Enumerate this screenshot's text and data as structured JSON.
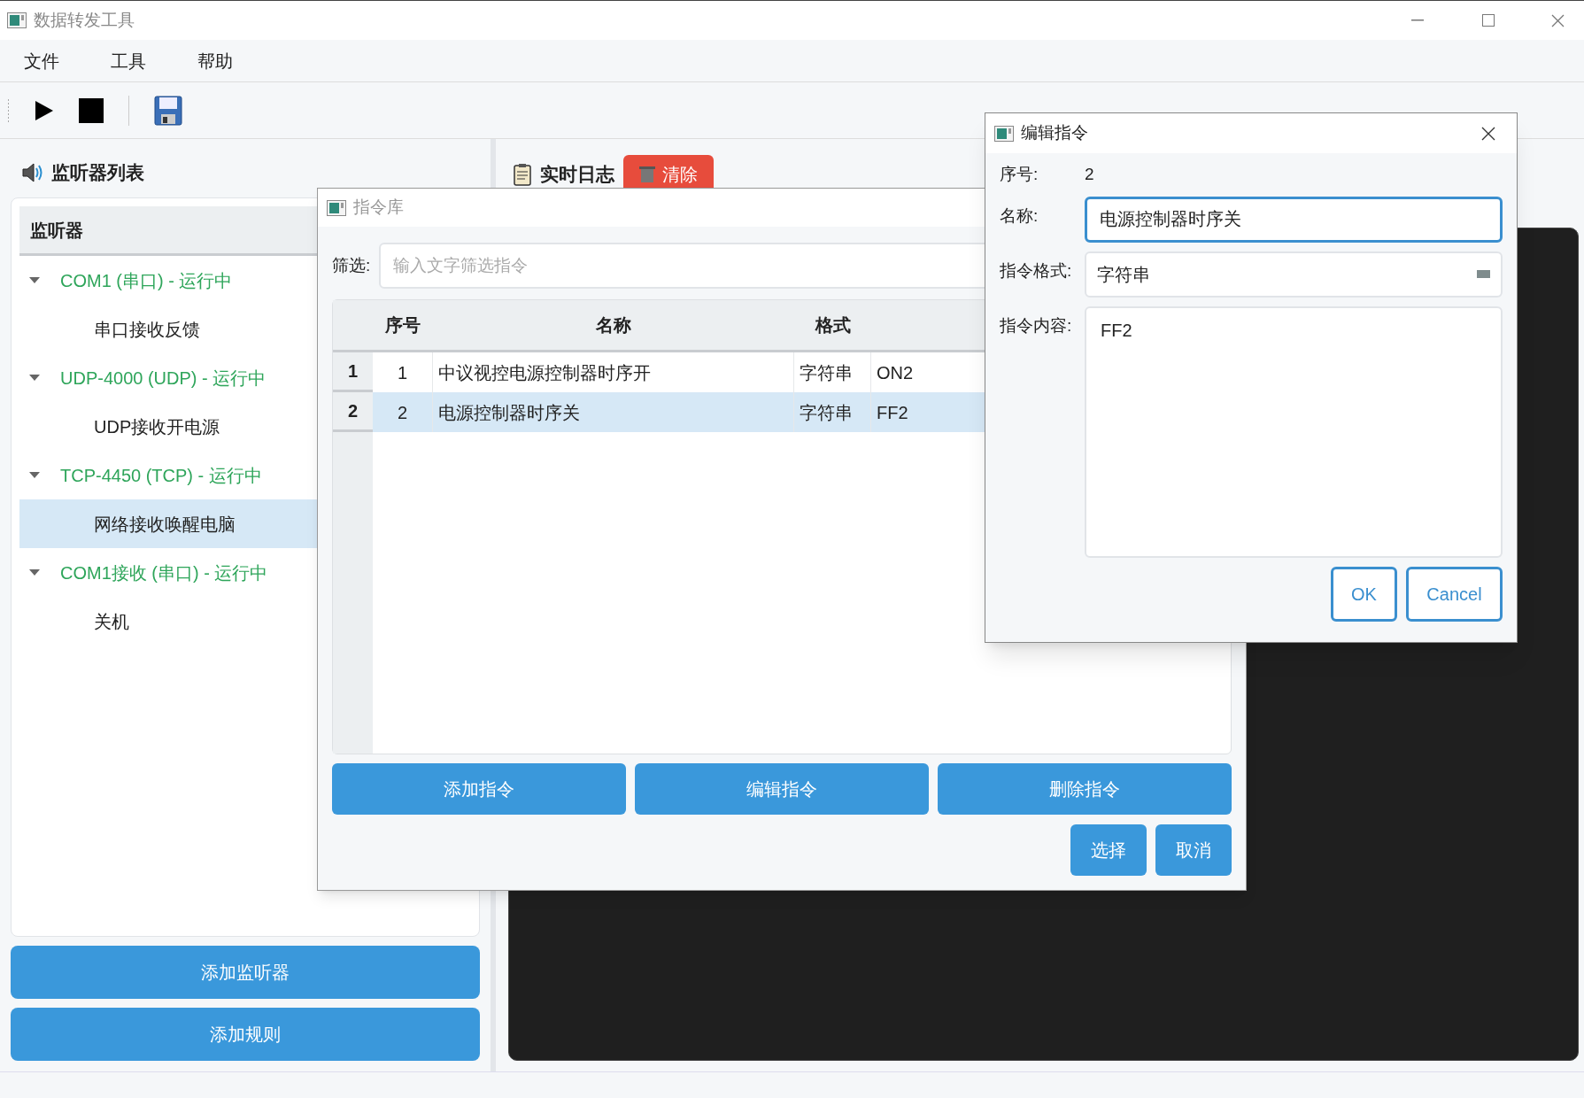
{
  "window": {
    "title": "数据转发工具"
  },
  "menu": [
    "文件",
    "工具",
    "帮助"
  ],
  "left_panel": {
    "title": "监听器列表",
    "tree_header": "监听器",
    "listeners": [
      {
        "label": "COM1 (串口) - 运行中",
        "expanded": true,
        "color": "#2ea55a",
        "children": [
          {
            "label": "串口接收反馈",
            "selected": false
          }
        ]
      },
      {
        "label": "UDP-4000 (UDP) - 运行中",
        "expanded": true,
        "color": "#2ea55a",
        "children": [
          {
            "label": "UDP接收开电源",
            "selected": false
          }
        ]
      },
      {
        "label": "TCP-4450 (TCP) - 运行中",
        "expanded": true,
        "color": "#2ea55a",
        "children": [
          {
            "label": "网络接收唤醒电脑",
            "selected": true
          }
        ]
      },
      {
        "label": "COM1接收 (串口) - 运行中",
        "expanded": true,
        "color": "#2ea55a",
        "children": [
          {
            "label": "关机",
            "selected": false
          }
        ]
      }
    ],
    "buttons": [
      "添加监听器",
      "添加规则"
    ]
  },
  "log_panel": {
    "title": "实时日志",
    "clear_button": "清除"
  },
  "command_library": {
    "title": "指令库",
    "filter_label": "筛选:",
    "filter_placeholder": "输入文字筛选指令",
    "columns": [
      "序号",
      "名称",
      "格式",
      ""
    ],
    "rows": [
      {
        "header": "1",
        "cells": [
          "1",
          "中议视控电源控制器时序开",
          "字符串",
          "ON2"
        ],
        "selected": false
      },
      {
        "header": "2",
        "cells": [
          "2",
          "电源控制器时序关",
          "字符串",
          "FF2"
        ],
        "selected": true
      }
    ],
    "action_buttons": [
      "添加指令",
      "编辑指令",
      "删除指令"
    ],
    "dialog_buttons": [
      "选择",
      "取消"
    ]
  },
  "edit_dialog": {
    "title": "编辑指令",
    "index_label": "序号:",
    "index_value": "2",
    "name_label": "名称:",
    "name_value": "电源控制器时序关",
    "format_label": "指令格式:",
    "format_value": "字符串",
    "content_label": "指令内容:",
    "content_value": "FF2",
    "ok": "OK",
    "cancel": "Cancel"
  }
}
